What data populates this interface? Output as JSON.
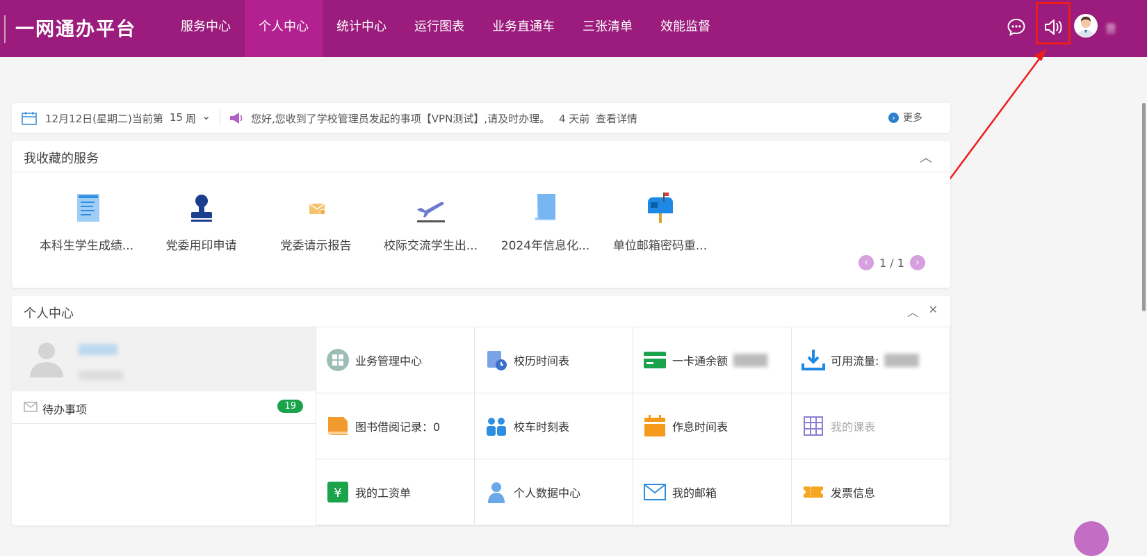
{
  "brand": "一网通办平台",
  "nav": [
    "服务中心",
    "个人中心",
    "统计中心",
    "运行图表",
    "业务直通车",
    "三张清单",
    "效能监督"
  ],
  "nav_active_index": 1,
  "icons": {
    "chat": "chat-icon",
    "speaker": "speaker-icon",
    "avatar": "user-avatar"
  },
  "user_name": "曹",
  "notice": {
    "date": "12月12日(星期二)当前第",
    "week": "15",
    "week_unit": "周",
    "message": "您好,您收到了学校管理员发起的事项【VPN测试】,请及时办理。",
    "time_ago": "4 天前",
    "detail_link": "查看详情",
    "more": "更多"
  },
  "favorites": {
    "title": "我收藏的服务",
    "items": [
      {
        "label": "本科生学生成绩...",
        "icon": "document-icon",
        "color": "#2e8fe0"
      },
      {
        "label": "党委用印申请",
        "icon": "stamp-icon",
        "color": "#1b3f8f"
      },
      {
        "label": "党委请示报告",
        "icon": "envelope-icon",
        "color": "#f2b04c"
      },
      {
        "label": "校际交流学生出...",
        "icon": "airplane-icon",
        "color": "#6b7bd0"
      },
      {
        "label": "2024年信息化...",
        "icon": "paper-icon",
        "color": "#77b6f0"
      },
      {
        "label": "单位邮箱密码重...",
        "icon": "mailbox-icon",
        "color": "#1e88e5"
      }
    ],
    "pager": "1 / 1"
  },
  "personal": {
    "title": "个人中心",
    "todo_label": "待办事项",
    "todo_count": "19",
    "grid": [
      {
        "label": "业务管理中心",
        "icon": "grid-circle-icon",
        "color": "#9bbdb6"
      },
      {
        "label": "校历时间表",
        "icon": "calendar-clock-icon",
        "color": "#6b8fd9"
      },
      {
        "label": "一卡通余额",
        "icon": "card-icon",
        "color": "#1aa34a"
      },
      {
        "label": "可用流量:",
        "icon": "download-tray-icon",
        "color": "#1e88e5"
      },
      {
        "label": "图书借阅记录：0",
        "icon": "book-icon",
        "color": "#f29a2e"
      },
      {
        "label": "校车时刻表",
        "icon": "people-icon",
        "color": "#2e8fe0"
      },
      {
        "label": "作息时间表",
        "icon": "schedule-icon",
        "color": "#f59a1b"
      },
      {
        "label": "我的课表",
        "icon": "table-icon",
        "color": "#8a7fd6",
        "dim": true
      },
      {
        "label": "我的工资单",
        "icon": "yen-icon",
        "color": "#1aa34a"
      },
      {
        "label": "个人数据中心",
        "icon": "person-icon",
        "color": "#6aa8e8"
      },
      {
        "label": "我的邮箱",
        "icon": "mail-icon",
        "color": "#2e8fe0"
      },
      {
        "label": "发票信息",
        "icon": "ticket-icon",
        "color": "#f5a623"
      }
    ]
  }
}
